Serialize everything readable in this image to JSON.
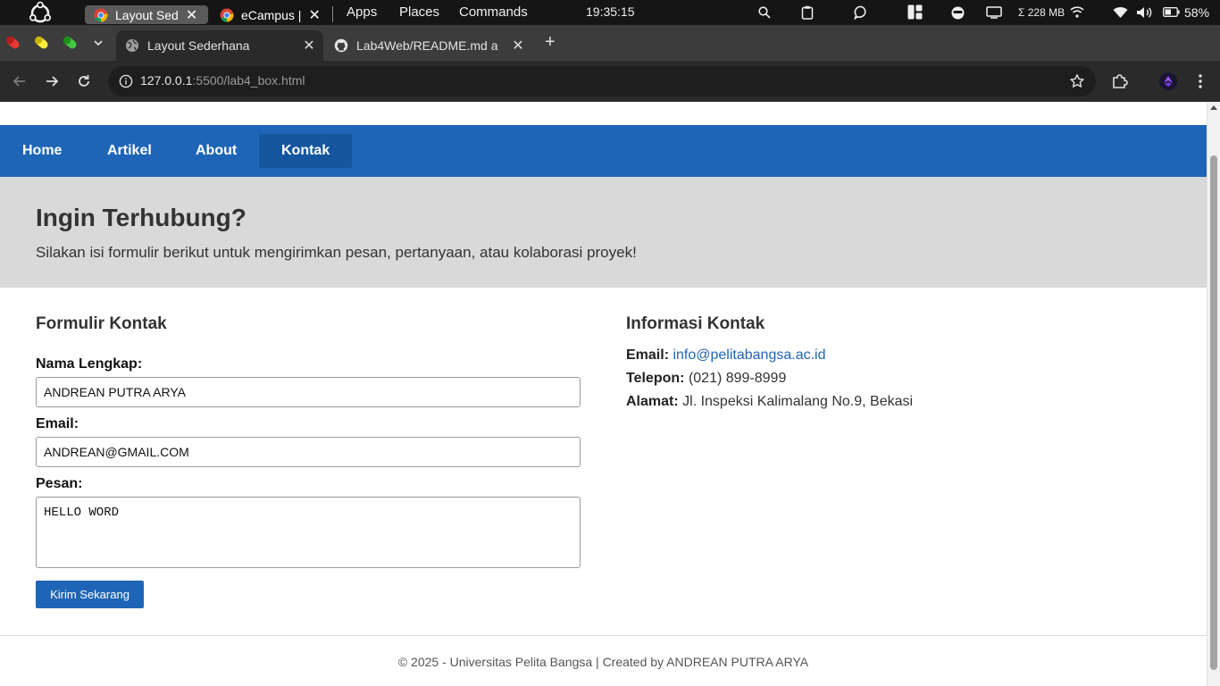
{
  "os_bar": {
    "tasks": [
      "Layout Sed",
      "eCampus |"
    ],
    "menus": [
      "Apps",
      "Places",
      "Commands"
    ],
    "clock": "19:35:15",
    "memory": "Σ 228 MB",
    "battery": "58%"
  },
  "browser": {
    "tabs": [
      {
        "title": "Layout Sederhana",
        "active": true
      },
      {
        "title": "Lab4Web/README.md a",
        "active": false
      }
    ],
    "url_host": "127.0.0.1",
    "url_rest": ":5500/lab4_box.html"
  },
  "page": {
    "nav": [
      "Home",
      "Artikel",
      "About",
      "Kontak"
    ],
    "active_nav": "Kontak",
    "hero": {
      "title": "Ingin Terhubung?",
      "subtitle": "Silakan isi formulir berikut untuk mengirimkan pesan, pertanyaan, atau kolaborasi proyek!"
    },
    "form": {
      "title": "Formulir Kontak",
      "name_label": "Nama Lengkap:",
      "name_value": "ANDREAN PUTRA ARYA",
      "email_label": "Email:",
      "email_value": "ANDREAN@GMAIL.COM",
      "message_label": "Pesan:",
      "message_value": "HELLO WORD",
      "submit_label": "Kirim Sekarang"
    },
    "info": {
      "title": "Informasi Kontak",
      "email_label": "Email:",
      "email_value": "info@pelitabangsa.ac.id",
      "phone_label": "Telepon:",
      "phone_value": "(021) 899-8999",
      "address_label": "Alamat:",
      "address_value": "Jl. Inspeksi Kalimalang No.9, Bekasi"
    },
    "footer": "© 2025 - Universitas Pelita Bangsa | Created by ANDREAN PUTRA ARYA"
  },
  "colors": {
    "primary": "#1f65b7",
    "nav_active": "#15569f",
    "hero_bg": "#d9d9d9"
  }
}
